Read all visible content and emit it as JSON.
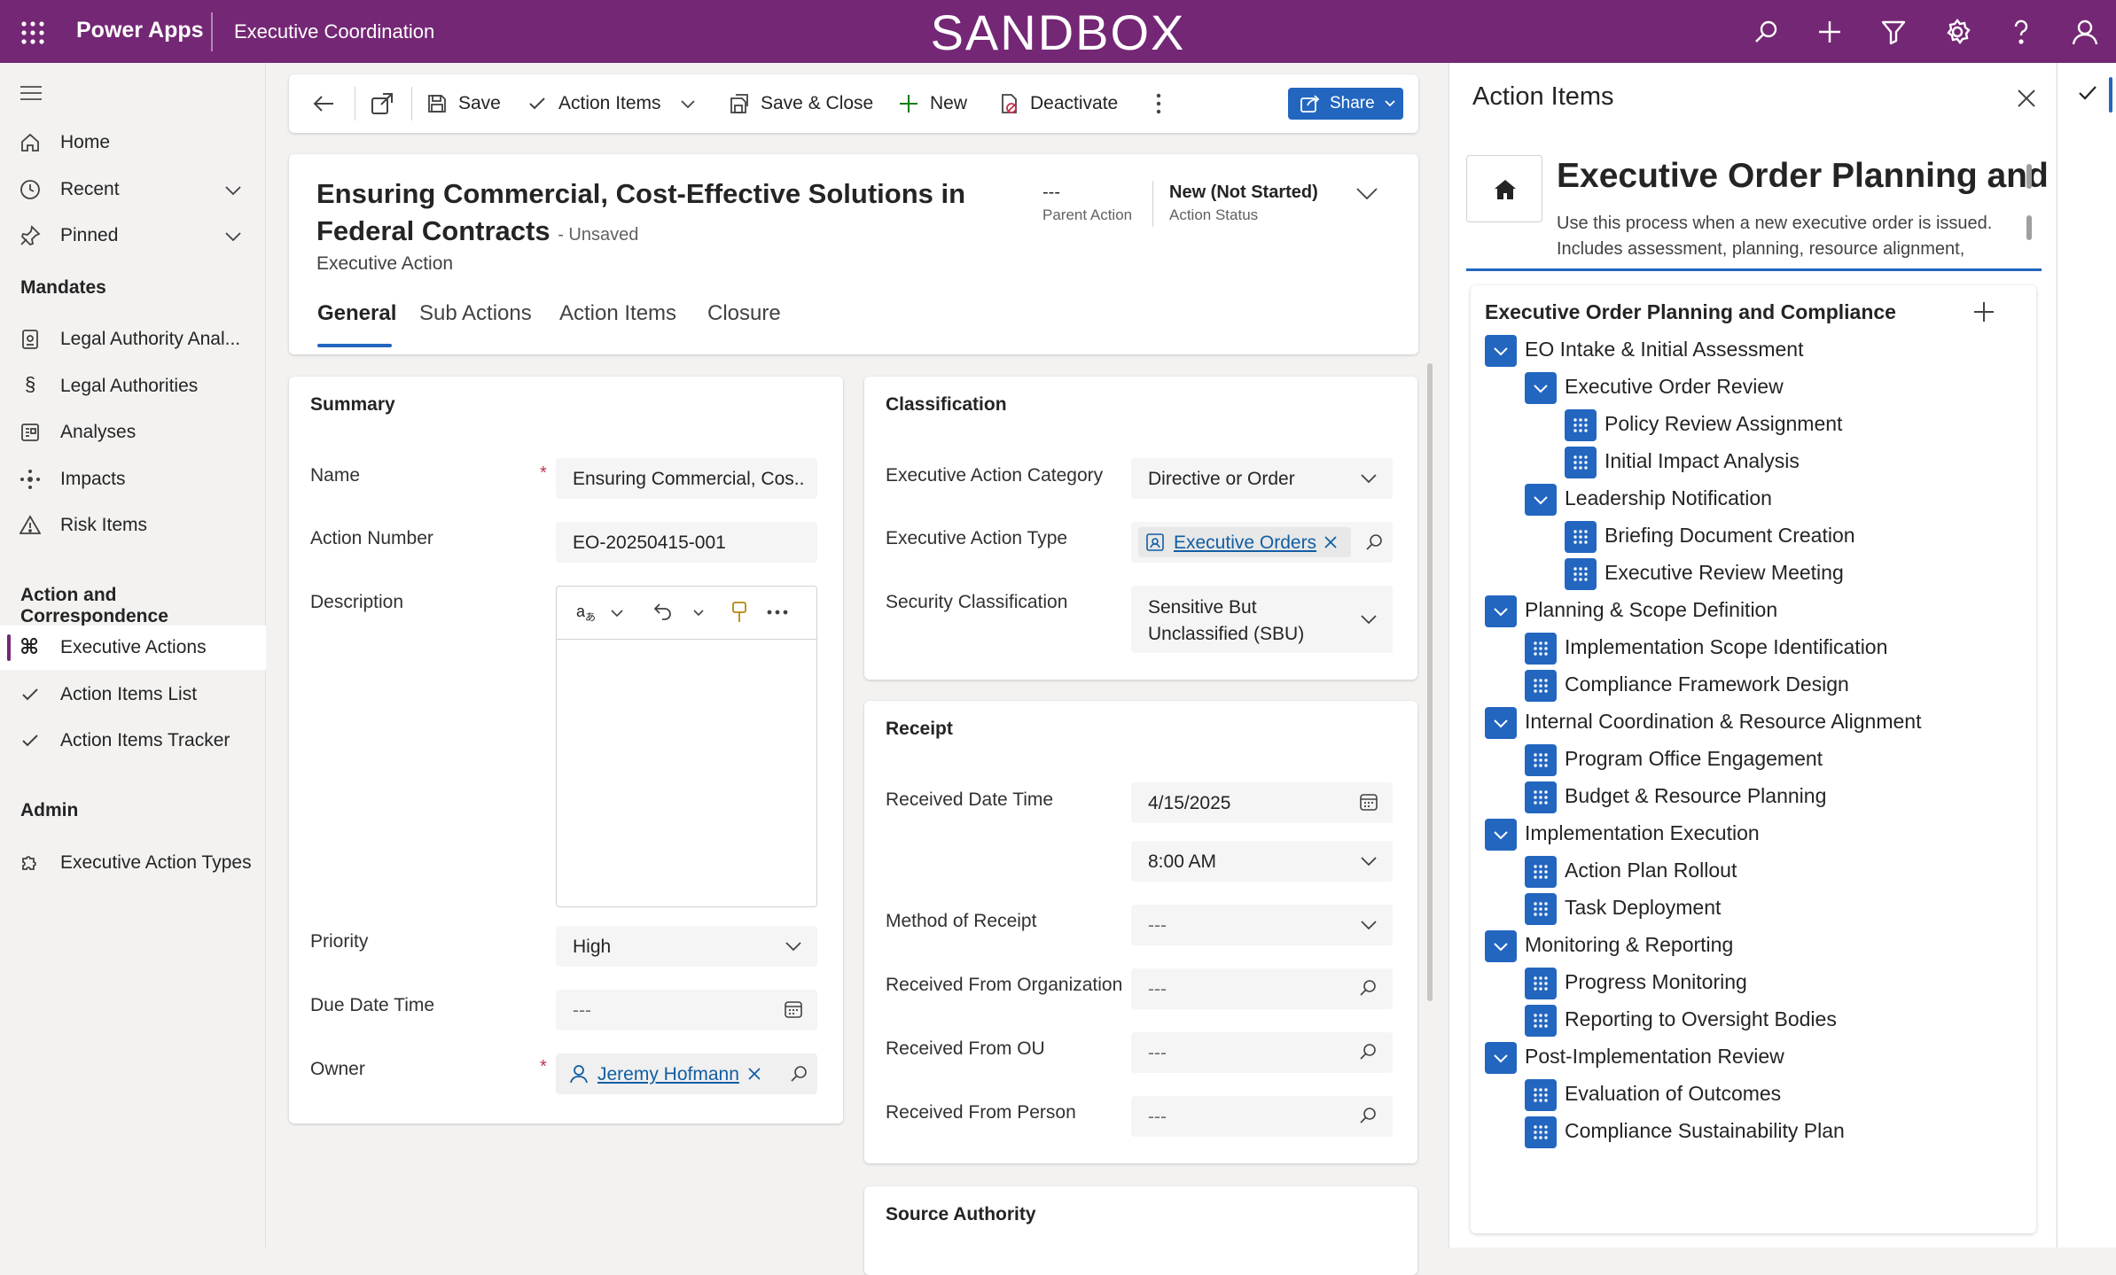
{
  "topbar": {
    "app_name": "Power Apps",
    "env_name": "Executive Coordination",
    "banner": "SANDBOX",
    "icons": [
      "search-icon",
      "add-icon",
      "filter-icon",
      "settings-icon",
      "help-icon",
      "user-icon"
    ]
  },
  "nav": {
    "home": "Home",
    "recent": "Recent",
    "pinned": "Pinned",
    "mandates_header": "Mandates",
    "legal_authority_analysis": "Legal Authority Anal...",
    "legal_authorities": "Legal Authorities",
    "analyses": "Analyses",
    "impacts": "Impacts",
    "risk_items": "Risk Items",
    "action_header": "Action and Correspondence",
    "executive_actions": "Executive Actions",
    "action_items_list": "Action Items List",
    "action_items_tracker": "Action Items Tracker",
    "admin_header": "Admin",
    "executive_action_types": "Executive Action Types"
  },
  "commandbar": {
    "save": "Save",
    "action_items": "Action Items",
    "save_close": "Save & Close",
    "new": "New",
    "deactivate": "Deactivate",
    "share": "Share"
  },
  "header": {
    "title_line1": "Ensuring Commercial, Cost-Effective Solutions in",
    "title_line2": "Federal Contracts",
    "unsaved": "- Unsaved",
    "entity": "Executive Action",
    "parent_action_value": "---",
    "parent_action_label": "Parent Action",
    "action_status_value": "New (Not Started)",
    "action_status_label": "Action Status"
  },
  "tabs": [
    "General",
    "Sub Actions",
    "Action Items",
    "Closure"
  ],
  "summary": {
    "title": "Summary",
    "name_label": "Name",
    "name_value": "Ensuring Commercial, Cos...",
    "action_number_label": "Action Number",
    "action_number_value": "EO-20250415-001",
    "description_label": "Description",
    "priority_label": "Priority",
    "priority_value": "High",
    "due_label": "Due Date Time",
    "due_value": "---",
    "owner_label": "Owner",
    "owner_value": "Jeremy Hofmann"
  },
  "classification": {
    "title": "Classification",
    "category_label": "Executive Action Category",
    "category_value": "Directive or Order",
    "type_label": "Executive Action Type",
    "type_value": "Executive Orders",
    "security_label": "Security Classification",
    "security_line1": "Sensitive But",
    "security_line2": "Unclassified (SBU)"
  },
  "receipt": {
    "title": "Receipt",
    "received_dt_label": "Received Date Time",
    "date_value": "4/15/2025",
    "time_value": "8:00 AM",
    "method_label": "Method of Receipt",
    "method_value": "---",
    "org_label": "Received From Organization",
    "org_value": "---",
    "ou_label": "Received From OU",
    "ou_value": "---",
    "person_label": "Received From Person",
    "person_value": "---"
  },
  "source_authority": {
    "title": "Source Authority"
  },
  "panel": {
    "title": "Action Items",
    "process_title": "Executive Order Planning and",
    "process_desc_line1": "Use this process when a new executive order is issued.",
    "process_desc_line2": "Includes assessment, planning, resource alignment,",
    "tree_root": "Executive Order Planning and Compliance",
    "tree": [
      {
        "label": "EO Intake & Initial Assessment",
        "level": 0,
        "kind": "group"
      },
      {
        "label": "Executive Order Review",
        "level": 1,
        "kind": "group"
      },
      {
        "label": "Policy Review Assignment",
        "level": 2,
        "kind": "item"
      },
      {
        "label": "Initial Impact Analysis",
        "level": 2,
        "kind": "item"
      },
      {
        "label": "Leadership Notification",
        "level": 1,
        "kind": "group"
      },
      {
        "label": "Briefing Document Creation",
        "level": 2,
        "kind": "item"
      },
      {
        "label": "Executive Review Meeting",
        "level": 2,
        "kind": "item"
      },
      {
        "label": "Planning & Scope Definition",
        "level": 0,
        "kind": "group"
      },
      {
        "label": "Implementation Scope Identification",
        "level": 1,
        "kind": "item"
      },
      {
        "label": "Compliance Framework Design",
        "level": 1,
        "kind": "item"
      },
      {
        "label": "Internal Coordination & Resource Alignment",
        "level": 0,
        "kind": "group"
      },
      {
        "label": "Program Office Engagement",
        "level": 1,
        "kind": "item"
      },
      {
        "label": "Budget & Resource Planning",
        "level": 1,
        "kind": "item"
      },
      {
        "label": "Implementation Execution",
        "level": 0,
        "kind": "group"
      },
      {
        "label": "Action Plan Rollout",
        "level": 1,
        "kind": "item"
      },
      {
        "label": "Task Deployment",
        "level": 1,
        "kind": "item"
      },
      {
        "label": "Monitoring & Reporting",
        "level": 0,
        "kind": "group"
      },
      {
        "label": "Progress Monitoring",
        "level": 1,
        "kind": "item"
      },
      {
        "label": "Reporting to Oversight Bodies",
        "level": 1,
        "kind": "item"
      },
      {
        "label": "Post-Implementation Review",
        "level": 0,
        "kind": "group"
      },
      {
        "label": "Evaluation of Outcomes",
        "level": 1,
        "kind": "item"
      },
      {
        "label": "Compliance Sustainability Plan",
        "level": 1,
        "kind": "item"
      }
    ]
  },
  "colors": {
    "brand": "#742774",
    "accent": "#2266c0",
    "link": "#115ea3",
    "required": "#c4314b"
  }
}
